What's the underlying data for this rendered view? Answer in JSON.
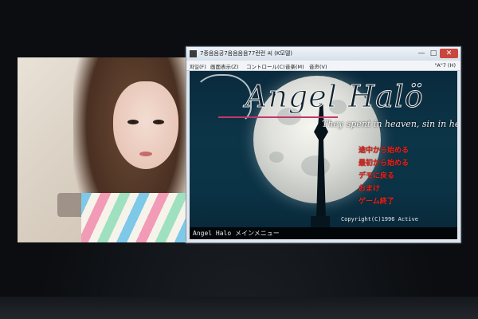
{
  "window": {
    "title": "7중음음공7음음음음77런런 씨 (K모델)",
    "min_label": "—",
    "max_label": "□",
    "close_label": "✕"
  },
  "menubar": {
    "items": [
      "파일(F)",
      "画面表示(Z)",
      "コントロール(C)",
      "音楽(M)",
      "音声(V)"
    ],
    "right": "\"A\"7 (H)"
  },
  "game": {
    "logo": "Angel Halö",
    "subtitle": "They spent in heaven, sin in hell.",
    "menu_options": [
      "途中から始める",
      "最初から始める",
      "デモに戻る",
      "おまけ",
      "ゲーム終了"
    ],
    "copyright": "Copyright(C)1996 Active",
    "status": "Angel Halo メインメニュー"
  },
  "colors": {
    "menu_text": "#e0261f",
    "game_bg": "#0c3548",
    "close_button": "#c9463d"
  },
  "icons": [
    "app-icon"
  ]
}
